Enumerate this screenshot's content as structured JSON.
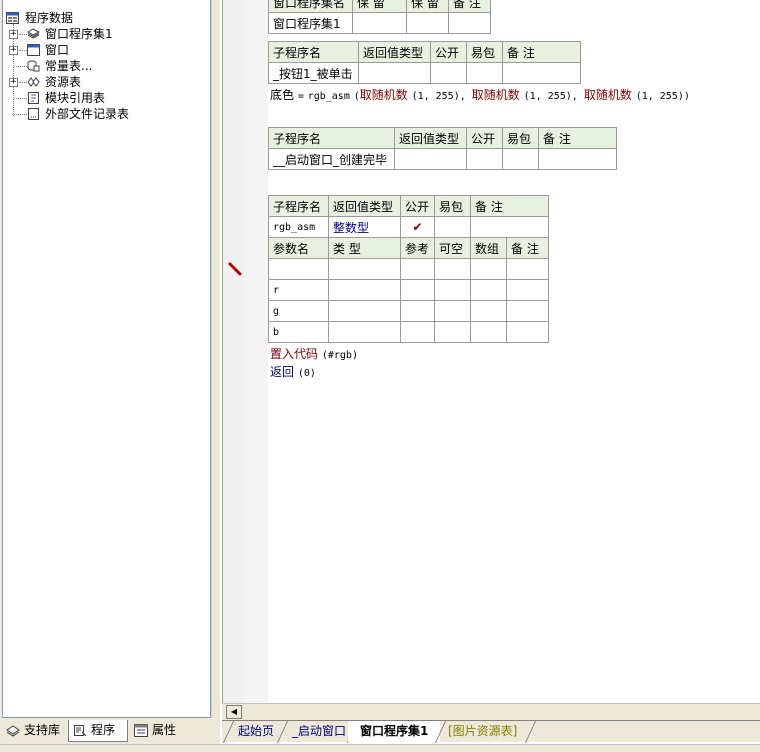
{
  "tree": {
    "root": "程序数据",
    "items": [
      {
        "label": "窗口程序集1",
        "icon": "program-set-icon"
      },
      {
        "label": "窗口",
        "icon": "window-icon"
      },
      {
        "label": "常量表...",
        "icon": "constant-table-icon"
      },
      {
        "label": "资源表",
        "icon": "resource-table-icon"
      },
      {
        "label": "模块引用表",
        "icon": "module-ref-icon"
      },
      {
        "label": "外部文件记录表",
        "icon": "external-file-icon"
      }
    ]
  },
  "left_tabs": [
    {
      "label": "支持库",
      "icon": "library-icon"
    },
    {
      "label": "程序",
      "icon": "program-icon"
    },
    {
      "label": "属性",
      "icon": "property-icon"
    }
  ],
  "assembly_table": {
    "headers": [
      "窗口程序集名",
      "保 留",
      "保 留",
      "备 注"
    ],
    "row": [
      "窗口程序集1",
      "",
      "",
      ""
    ]
  },
  "sub1": {
    "headers": [
      "子程序名",
      "返回值类型",
      "公开",
      "易包",
      "备 注"
    ],
    "row": [
      "_按钮1_被单击",
      "",
      "",
      "",
      ""
    ],
    "code": {
      "target": "底色",
      "op": "=",
      "func": "rgb_asm",
      "open": "(",
      "rand": "取随机数",
      "args": "(1, 255)",
      "sep": ", ",
      "close": ")"
    }
  },
  "sub2": {
    "headers": [
      "子程序名",
      "返回值类型",
      "公开",
      "易包",
      "备 注"
    ],
    "row": [
      "__启动窗口_创建完毕",
      "",
      "",
      "",
      ""
    ]
  },
  "sub3": {
    "headers": [
      "子程序名",
      "返回值类型",
      "公开",
      "易包",
      "备 注"
    ],
    "row": [
      "rgb_asm",
      "整数型",
      "✔",
      "",
      ""
    ],
    "param_headers": [
      "参数名",
      "类 型",
      "参考",
      "可空",
      "数组",
      "备 注"
    ],
    "params": [
      "",
      "r",
      "g",
      "b"
    ],
    "code1_kw": "置入代码",
    "code1_arg": "(#rgb)",
    "code2_kw": "返回",
    "code2_arg": "(0)"
  },
  "doc_tabs": [
    {
      "label": "起始页",
      "color": "#000080"
    },
    {
      "label": "_启动窗口",
      "color": "#000080"
    },
    {
      "label": "窗口程序集1",
      "color": "#000000"
    },
    {
      "label": "[图片资源表]",
      "color": "#808000"
    }
  ],
  "colors": {
    "header_bg": "#e8f0e0",
    "keyword": "#800000",
    "type": "#000080"
  }
}
